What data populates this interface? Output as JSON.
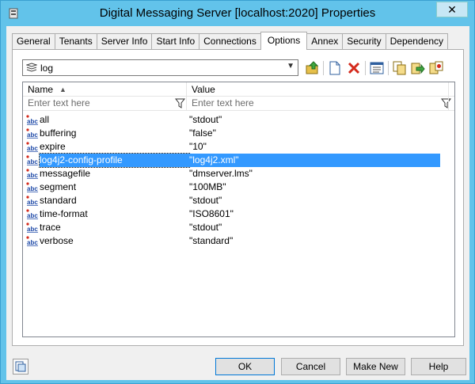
{
  "window": {
    "title": "Digital Messaging Server [localhost:2020] Properties",
    "close_label": "✕"
  },
  "tabs": [
    {
      "label": "General"
    },
    {
      "label": "Tenants"
    },
    {
      "label": "Server Info"
    },
    {
      "label": "Start Info"
    },
    {
      "label": "Connections"
    },
    {
      "label": "Options",
      "active": true
    },
    {
      "label": "Annex"
    },
    {
      "label": "Security"
    },
    {
      "label": "Dependency"
    }
  ],
  "section_select": {
    "value": "log"
  },
  "grid": {
    "headers": {
      "name": "Name",
      "value": "Value"
    },
    "filter_placeholder": "Enter text here",
    "rows": [
      {
        "name": "all",
        "value": "\"stdout\""
      },
      {
        "name": "buffering",
        "value": "\"false\""
      },
      {
        "name": "expire",
        "value": "\"10\""
      },
      {
        "name": "log4j2-config-profile",
        "value": "\"log4j2.xml\"",
        "selected": true
      },
      {
        "name": "messagefile",
        "value": "\"dmserver.lms\""
      },
      {
        "name": "segment",
        "value": "\"100MB\""
      },
      {
        "name": "standard",
        "value": "\"stdout\""
      },
      {
        "name": "time-format",
        "value": "\"ISO8601\""
      },
      {
        "name": "trace",
        "value": "\"stdout\""
      },
      {
        "name": "verbose",
        "value": "\"standard\""
      }
    ]
  },
  "buttons": {
    "ok": "OK",
    "cancel": "Cancel",
    "make_new": "Make New",
    "help": "Help"
  },
  "colors": {
    "titlebar": "#62c3ea",
    "selection": "#3399ff"
  }
}
